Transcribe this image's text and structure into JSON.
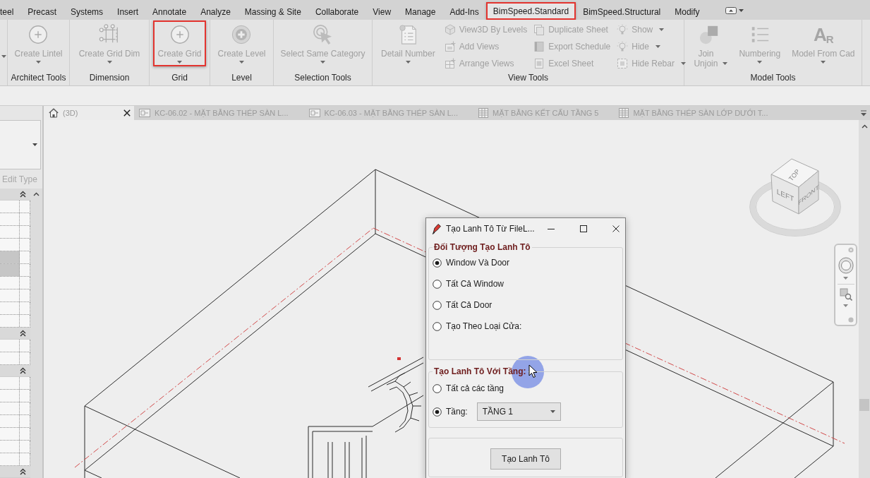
{
  "ribbon": {
    "tabs": [
      {
        "label": "teel",
        "selected": false,
        "highlighted": false
      },
      {
        "label": "Precast",
        "selected": false,
        "highlighted": false
      },
      {
        "label": "Systems",
        "selected": false,
        "highlighted": false
      },
      {
        "label": "Insert",
        "selected": false,
        "highlighted": false
      },
      {
        "label": "Annotate",
        "selected": false,
        "highlighted": false
      },
      {
        "label": "Analyze",
        "selected": false,
        "highlighted": false
      },
      {
        "label": "Massing & Site",
        "selected": false,
        "highlighted": false
      },
      {
        "label": "Collaborate",
        "selected": false,
        "highlighted": false
      },
      {
        "label": "View",
        "selected": false,
        "highlighted": false
      },
      {
        "label": "Manage",
        "selected": false,
        "highlighted": false
      },
      {
        "label": "Add-Ins",
        "selected": false,
        "highlighted": false
      },
      {
        "label": "BimSpeed.Standard",
        "selected": true,
        "highlighted": true
      },
      {
        "label": "BimSpeed.Structural",
        "selected": false,
        "highlighted": false
      },
      {
        "label": "Modify",
        "selected": false,
        "highlighted": false
      }
    ],
    "panels": [
      {
        "title": "Architect Tools",
        "buttons": [
          {
            "label": "Create Lintel",
            "kind": "large",
            "dropdown": true,
            "disabled": true,
            "highlighted": false
          }
        ]
      },
      {
        "title": "Dimension",
        "buttons": [
          {
            "label": "Create Grid Dim",
            "kind": "large",
            "dropdown": true,
            "disabled": true,
            "highlighted": false
          }
        ]
      },
      {
        "title": "Grid",
        "buttons": [
          {
            "label": "Create Grid",
            "kind": "large",
            "dropdown": true,
            "disabled": true,
            "highlighted": true
          }
        ]
      },
      {
        "title": "Level",
        "buttons": [
          {
            "label": "Create Level",
            "kind": "large",
            "dropdown": true,
            "disabled": true,
            "highlighted": false
          }
        ]
      },
      {
        "title": "Selection Tools",
        "buttons": [
          {
            "label": "Select Same Category",
            "kind": "large",
            "dropdown": true,
            "disabled": true,
            "highlighted": false
          }
        ]
      },
      {
        "title": "View Tools",
        "buttons": [
          {
            "label": "Detail Number",
            "kind": "large",
            "dropdown": true,
            "disabled": true,
            "highlighted": false
          },
          {
            "label": "View3D By Levels",
            "kind": "small",
            "dropdown": false,
            "disabled": true,
            "highlighted": false
          },
          {
            "label": "Add Views",
            "kind": "small",
            "dropdown": false,
            "disabled": true,
            "highlighted": false
          },
          {
            "label": "Arrange Views",
            "kind": "small",
            "dropdown": false,
            "disabled": true,
            "highlighted": false
          },
          {
            "label": "Duplicate Sheet",
            "kind": "small",
            "dropdown": false,
            "disabled": true,
            "highlighted": false
          },
          {
            "label": "Export Schedule",
            "kind": "small",
            "dropdown": false,
            "disabled": true,
            "highlighted": false
          },
          {
            "label": "Excel Sheet",
            "kind": "small",
            "dropdown": false,
            "disabled": true,
            "highlighted": false
          },
          {
            "label": "Show",
            "kind": "small",
            "dropdown": true,
            "disabled": true,
            "highlighted": false
          },
          {
            "label": "Hide",
            "kind": "small",
            "dropdown": true,
            "disabled": true,
            "highlighted": false
          },
          {
            "label": "Hide Rebar",
            "kind": "small",
            "dropdown": true,
            "disabled": true,
            "highlighted": false
          }
        ]
      },
      {
        "title": "Model Tools",
        "buttons": [
          {
            "label": "Join Unjoin",
            "kind": "split",
            "dropdown": true,
            "disabled": true,
            "highlighted": false
          },
          {
            "label": "Numbering",
            "kind": "large",
            "dropdown": true,
            "disabled": true,
            "highlighted": false
          },
          {
            "label": "Model From Cad",
            "kind": "large",
            "dropdown": true,
            "disabled": true,
            "highlighted": false,
            "icon_text": "A$_{R}$"
          }
        ]
      }
    ]
  },
  "properties": {
    "edit_type": {
      "label": "Edit Type",
      "disabled": true
    },
    "groups": [
      {
        "expanded": true,
        "rows": [
          {
            "shaded": false
          },
          {
            "shaded": false
          },
          {
            "shaded": false
          },
          {
            "shaded": false
          },
          {
            "shaded": true
          },
          {
            "shaded": true
          },
          {
            "shaded": false
          },
          {
            "shaded": false
          },
          {
            "shaded": false
          },
          {
            "shaded": false
          }
        ]
      },
      {
        "expanded": true,
        "rows": [
          {
            "shaded": false
          },
          {
            "shaded": false
          }
        ]
      },
      {
        "expanded": true,
        "rows": [
          {
            "shaded": false
          },
          {
            "shaded": false
          },
          {
            "shaded": false
          },
          {
            "shaded": false
          },
          {
            "shaded": false
          },
          {
            "shaded": false
          },
          {
            "shaded": false
          }
        ]
      },
      {
        "expanded": true
      }
    ]
  },
  "view_tabs": [
    {
      "label": "(3D)",
      "kind": "model",
      "selected": true
    },
    {
      "label": "KC-06.02 - MẶT BẰNG THÉP SÀN L...",
      "kind": "plan",
      "selected": false
    },
    {
      "label": "KC-06.03 - MẶT BẰNG THÉP SÀN L...",
      "kind": "plan",
      "selected": false
    },
    {
      "label": "MẶT BẰNG KẾT CẤU TẦNG 5",
      "kind": "table",
      "selected": false
    },
    {
      "label": "MẶT BẰNG THÉP SÀN LỚP DƯỚI T...",
      "kind": "table",
      "selected": false
    }
  ],
  "view_cube": {
    "faces": [
      "TOP",
      "LEFT",
      "FRONT"
    ]
  },
  "dialog": {
    "title": "Tạo Lanh Tô Từ FileL...",
    "groups": [
      {
        "title": "Đối Tượng Tạo Lanh Tô",
        "options": [
          {
            "label": "Window Và Door",
            "selected": true
          },
          {
            "label": "Tất Cả Window",
            "selected": false
          },
          {
            "label": "Tất Cả Door",
            "selected": false
          },
          {
            "label": "Tạo Theo Loại Cửa:",
            "selected": false
          }
        ]
      },
      {
        "title": "Tạo Lanh Tô Với Tầng:",
        "options": [
          {
            "label": "Tất cả các tầng",
            "selected": false
          },
          {
            "label": "Tầng:",
            "selected": true,
            "dropdown": {
              "value": "TẦNG 1"
            }
          }
        ]
      }
    ],
    "button": "Tạo Lanh Tô"
  }
}
